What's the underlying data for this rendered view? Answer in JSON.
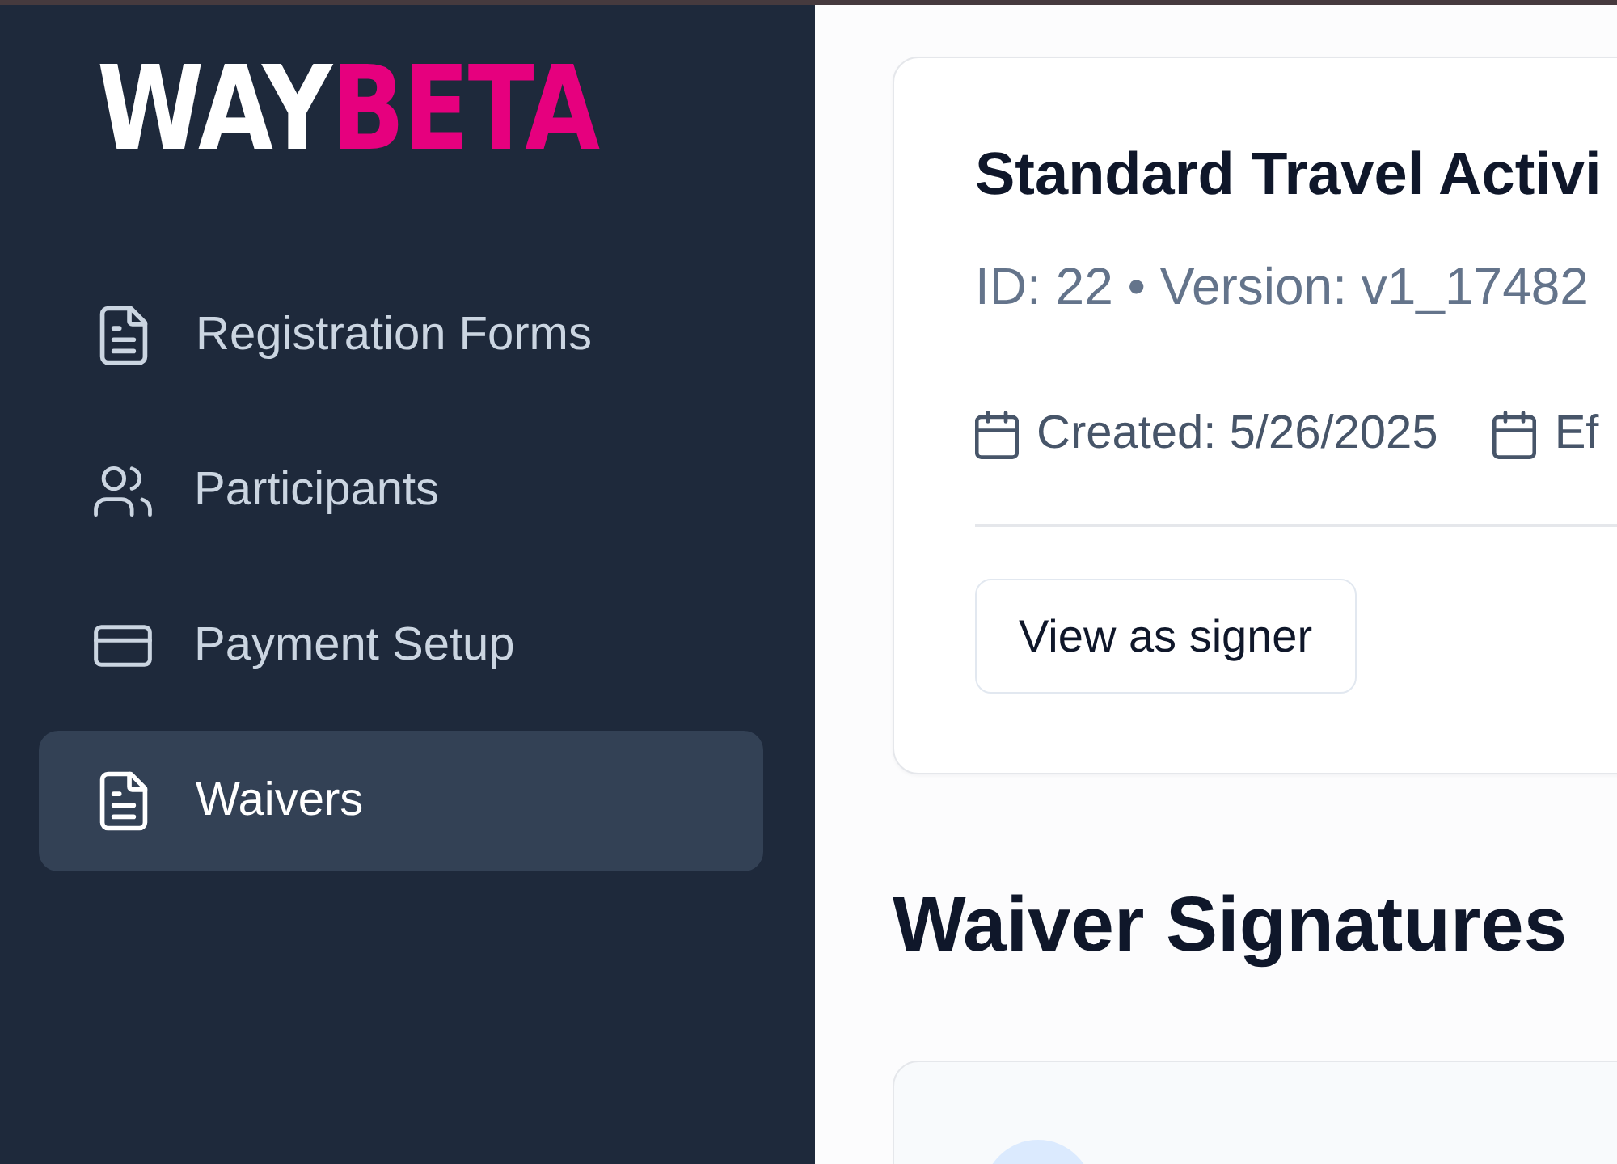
{
  "logo": {
    "parts": [
      {
        "text": "WAY",
        "color": "#ffffff"
      },
      {
        "text": "BETA",
        "color": "#e6007e"
      }
    ]
  },
  "sidebar": {
    "items": [
      {
        "label": "Registration Forms",
        "selected": false
      },
      {
        "label": "Participants",
        "selected": false
      },
      {
        "label": "Payment Setup",
        "selected": false
      },
      {
        "label": "Waivers",
        "selected": true
      }
    ]
  },
  "waiver": {
    "title": "Standard Travel Activi",
    "meta": "ID: 22 • Version: v1_17482",
    "dates": [
      "Created: 5/26/2025",
      "Ef"
    ],
    "button": "View as signer"
  },
  "signatures": {
    "heading": "Waiver Signatures",
    "rows": [
      {
        "kind": "signer"
      }
    ]
  }
}
